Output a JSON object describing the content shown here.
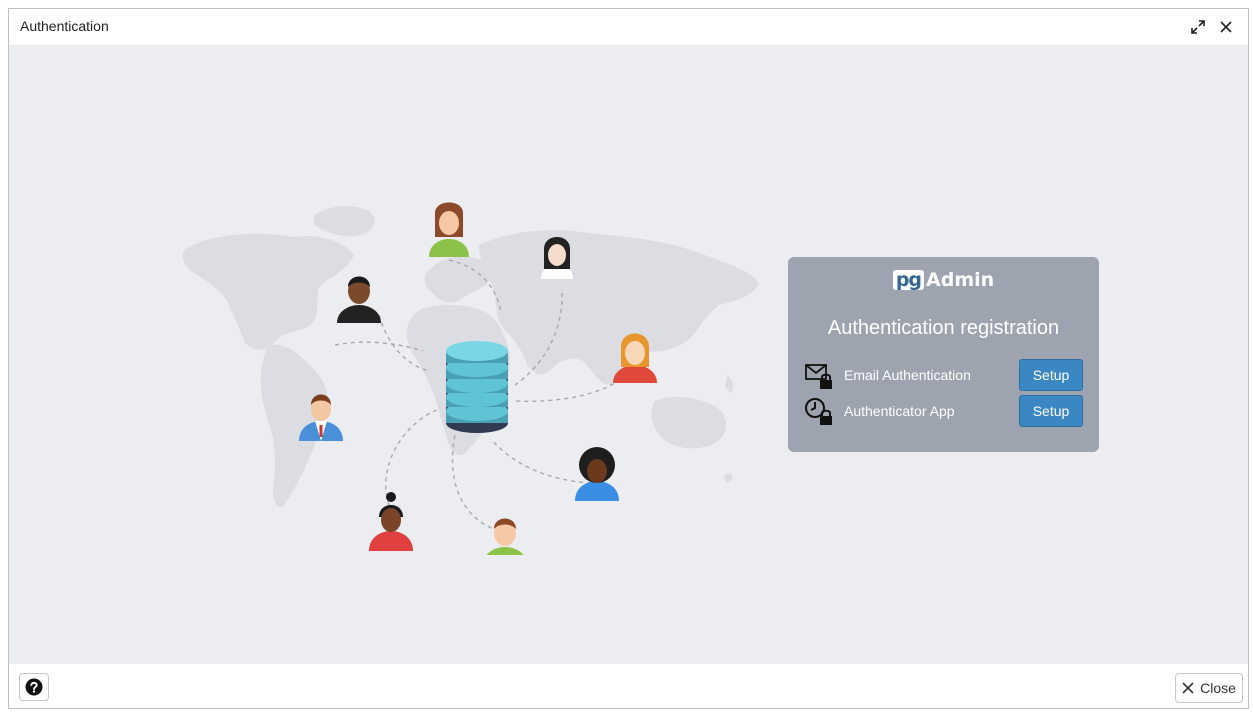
{
  "window": {
    "title": "Authentication"
  },
  "card": {
    "logo_prefix": "pg",
    "logo_suffix": "Admin",
    "title": "Authentication registration",
    "methods": [
      {
        "icon": "email-lock-icon",
        "label": "Email Authentication",
        "button": "Setup"
      },
      {
        "icon": "clock-lock-icon",
        "label": "Authenticator App",
        "button": "Setup"
      }
    ]
  },
  "footer": {
    "help_icon": "question-circle-icon",
    "close_label": "Close"
  },
  "colors": {
    "content_bg": "#ecedf1",
    "card_bg": "#9ea3b0",
    "button_blue": "#3b87c3",
    "db_teal": "#5fc5d6",
    "db_dark": "#3c4c63"
  }
}
